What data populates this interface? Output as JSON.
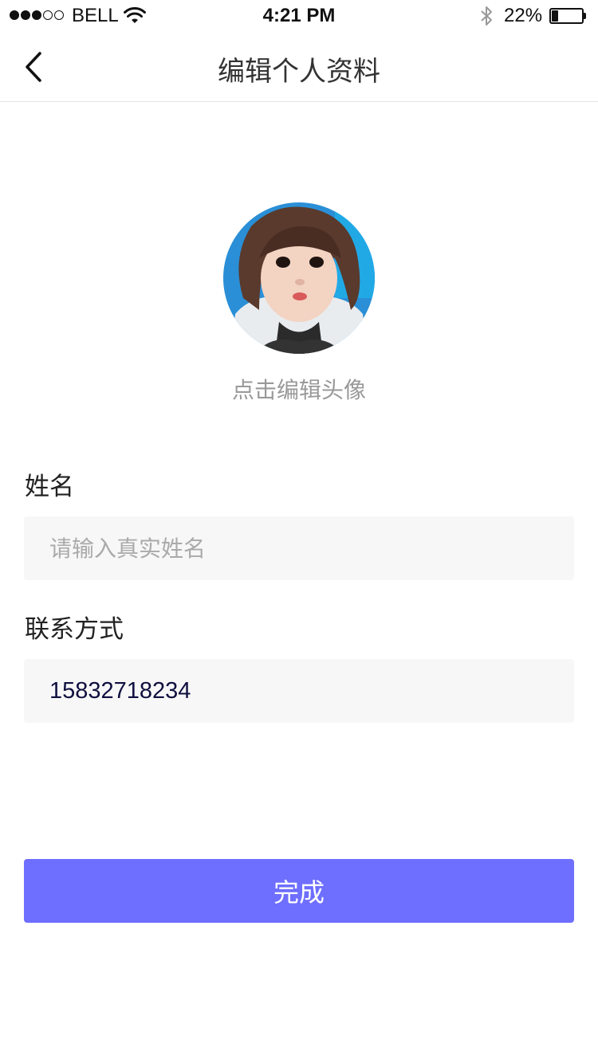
{
  "status_bar": {
    "signal_bars": 5,
    "signal_filled": 3,
    "carrier": "BELL",
    "time": "4:21 PM",
    "battery_percent": "22%",
    "battery_level": 0.22
  },
  "nav": {
    "title": "编辑个人资料",
    "back_icon": "chevron-left-icon"
  },
  "avatar": {
    "hint": "点击编辑头像"
  },
  "form": {
    "name_label": "姓名",
    "name_placeholder": "请输入真实姓名",
    "name_value": "",
    "contact_label": "联系方式",
    "contact_value": "15832718234"
  },
  "actions": {
    "done_label": "完成"
  },
  "colors": {
    "primary": "#6e6eff",
    "input_bg": "#f7f7f7"
  }
}
